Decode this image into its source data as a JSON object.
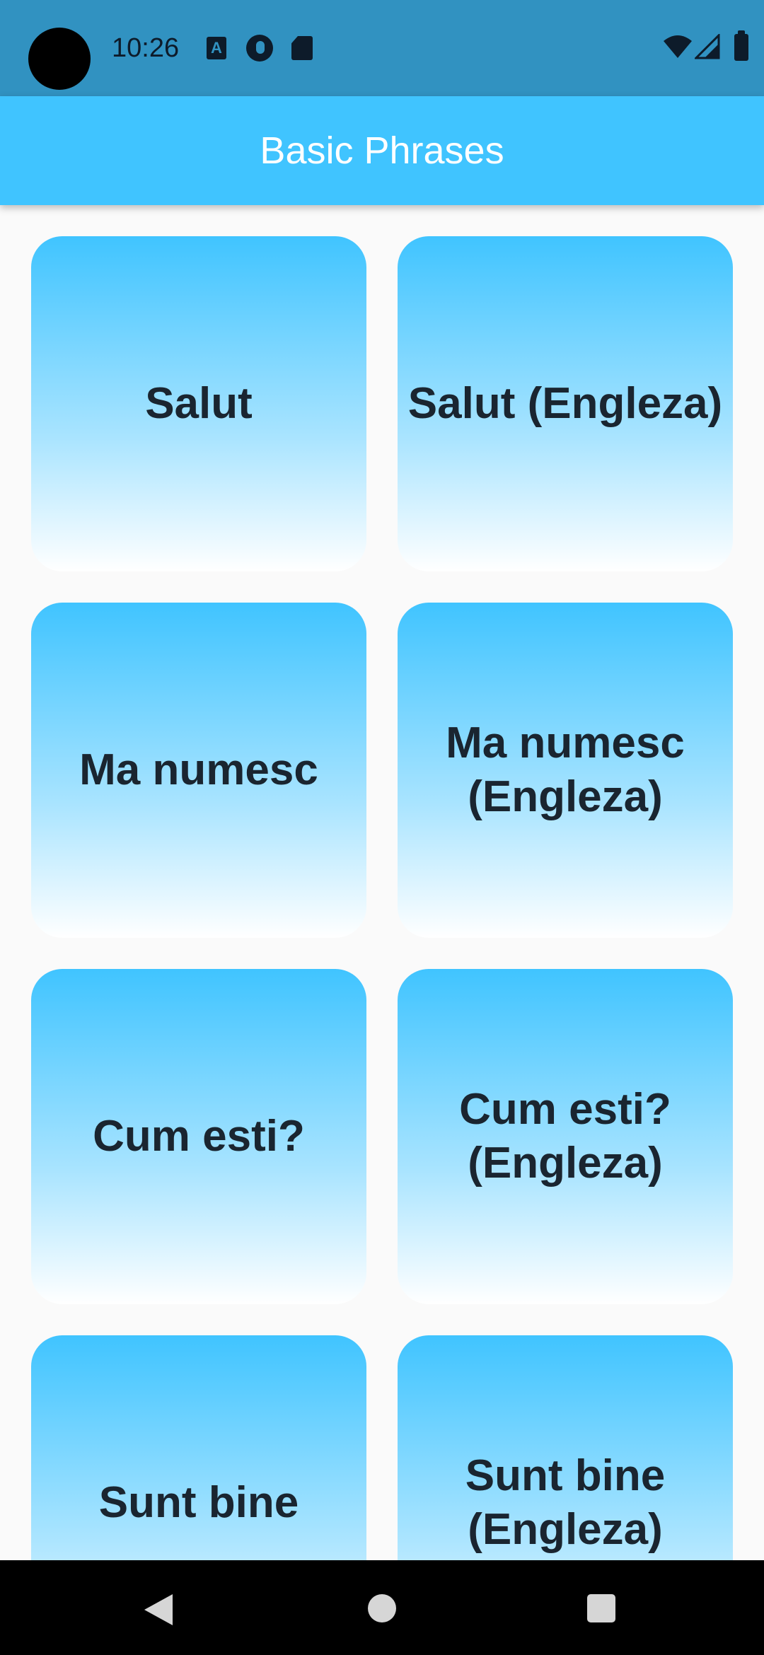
{
  "status_bar": {
    "time": "10:26",
    "notification_icons": [
      "text-a-icon",
      "p-badge-icon",
      "sd-card-icon"
    ],
    "system_icons": [
      "wifi-icon",
      "signal-icon",
      "battery-icon"
    ]
  },
  "app_bar": {
    "title": "Basic Phrases"
  },
  "tiles": [
    {
      "label": "Salut"
    },
    {
      "label": "Salut (Engleza)"
    },
    {
      "label": "Ma numesc"
    },
    {
      "label": "Ma numesc (Engleza)"
    },
    {
      "label": "Cum esti?"
    },
    {
      "label": "Cum esti? (Engleza)"
    },
    {
      "label": "Sunt bine"
    },
    {
      "label": "Sunt bine (Engleza)"
    }
  ],
  "nav_bar": {
    "buttons": [
      "back-icon",
      "home-icon",
      "recents-icon"
    ]
  },
  "colors": {
    "status_bar": "#3192c1",
    "app_bar": "#40c4ff",
    "tile_gradient_top": "#40c4ff",
    "tile_gradient_bottom": "#ffffff",
    "tile_text": "#1a2530",
    "background": "#fafafa"
  }
}
